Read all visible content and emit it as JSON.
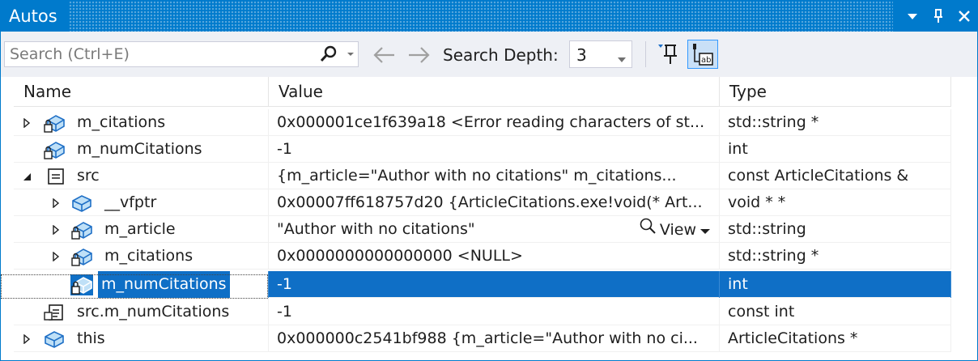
{
  "window": {
    "title": "Autos"
  },
  "toolbar": {
    "search_placeholder": "Search (Ctrl+E)",
    "search_depth_label": "Search Depth:",
    "search_depth_value": "3"
  },
  "columns": {
    "name": "Name",
    "value": "Value",
    "type": "Type"
  },
  "rows": [
    {
      "name": "m_citations",
      "value": "0x000001ce1f639a18 <Error reading characters of st...",
      "type": "std::string *"
    },
    {
      "name": "m_numCitations",
      "value": "-1",
      "type": "int"
    },
    {
      "name": "src",
      "value": "{m_article=\"Author with no citations\" m_citations...",
      "type": "const ArticleCitations &"
    },
    {
      "name": "__vfptr",
      "value": "0x00007ff618757d20 {ArticleCitations.exe!void(* Art...",
      "type": "void * *"
    },
    {
      "name": "m_article",
      "value": "\"Author with no citations\"",
      "type": "std::string",
      "visualizer": "View"
    },
    {
      "name": "m_citations",
      "value": "0x0000000000000000 <NULL>",
      "type": "std::string *"
    },
    {
      "name": "m_numCitations",
      "value": "-1",
      "type": "int"
    },
    {
      "name": "src.m_numCitations",
      "value": "-1",
      "type": "const int"
    },
    {
      "name": "this",
      "value": "0x000000c2541bf988 {m_article=\"Author with no ci...",
      "type": "ArticleCitations *"
    }
  ],
  "colors": {
    "accent": "#007acc",
    "selection": "#0f6fc6",
    "toolbar_bg": "#eef0f5"
  }
}
